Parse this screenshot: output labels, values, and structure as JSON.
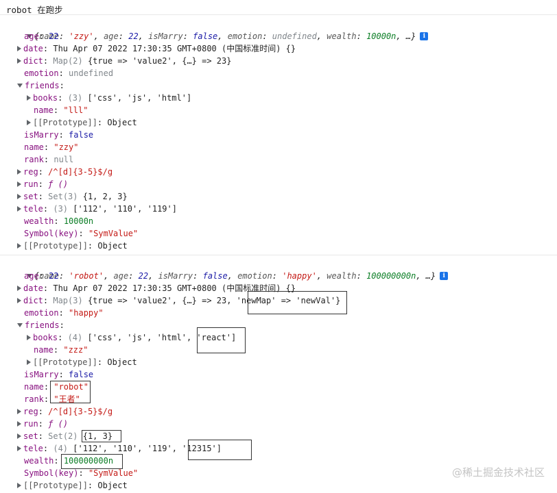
{
  "log": {
    "text": "robot 在跑步"
  },
  "first": {
    "summary": {
      "open": "{",
      "name_key": "name",
      "name_val": "'zzy'",
      "age_key": "age",
      "age_val": "22",
      "isMarry_key": "isMarry",
      "isMarry_val": "false",
      "emotion_key": "emotion",
      "emotion_val": "undefined",
      "wealth_key": "wealth",
      "wealth_val": "10000n",
      "tail": ", …}"
    },
    "age": {
      "key": "age",
      "val": "22"
    },
    "date": {
      "key": "date",
      "val": "Thu Apr 07 2022 17:30:35 GMT+0800 (中国标准时间) {}"
    },
    "dict": {
      "key": "dict",
      "pre": "Map(2) ",
      "val": "{true => 'value2', {…} => 23}"
    },
    "emotion": {
      "key": "emotion",
      "val": "undefined"
    },
    "friends": {
      "key": "friends",
      "books": {
        "key": "books",
        "pre": "(3) ",
        "val": "['css', 'js', 'html']"
      },
      "name": {
        "key": "name",
        "val": "\"lll\""
      },
      "proto": {
        "key": "[[Prototype]]",
        "val": "Object"
      }
    },
    "isMarry": {
      "key": "isMarry",
      "val": "false"
    },
    "name": {
      "key": "name",
      "val": "\"zzy\""
    },
    "rank": {
      "key": "rank",
      "val": "null"
    },
    "reg": {
      "key": "reg",
      "val": "/^[d]{3-5}$/g"
    },
    "run": {
      "key": "run",
      "val": "ƒ ()"
    },
    "set": {
      "key": "set",
      "pre": "Set(3) ",
      "val": "{1, 2, 3}"
    },
    "tele": {
      "key": "tele",
      "pre": "(3) ",
      "val": "['112', '110', '119']"
    },
    "wealth": {
      "key": "wealth",
      "val": "10000n"
    },
    "symbol": {
      "key": "Symbol(key)",
      "val": "\"SymValue\""
    },
    "proto": {
      "key": "[[Prototype]]",
      "val": "Object"
    }
  },
  "second": {
    "summary": {
      "open": "{",
      "name_key": "name",
      "name_val": "'robot'",
      "age_key": "age",
      "age_val": "22",
      "isMarry_key": "isMarry",
      "isMarry_val": "false",
      "emotion_key": "emotion",
      "emotion_val": "'happy'",
      "wealth_key": "wealth",
      "wealth_val": "100000000n",
      "tail": ", …}"
    },
    "age": {
      "key": "age",
      "val": "22"
    },
    "date": {
      "key": "date",
      "val": "Thu Apr 07 2022 17:30:35 GMT+0800 (中国标准时间) {}"
    },
    "dict": {
      "key": "dict",
      "pre": "Map(3) ",
      "val": "{true => 'value2', {…} => 23, 'newMap' => 'newVal'}"
    },
    "emotion": {
      "key": "emotion",
      "val": "\"happy\""
    },
    "friends": {
      "key": "friends",
      "books": {
        "key": "books",
        "pre": "(4) ",
        "val": "['css', 'js', 'html', 'react']"
      },
      "name": {
        "key": "name",
        "val": "\"zzz\""
      },
      "proto": {
        "key": "[[Prototype]]",
        "val": "Object"
      }
    },
    "isMarry": {
      "key": "isMarry",
      "val": "false"
    },
    "name": {
      "key": "name",
      "val": "\"robot\""
    },
    "rank": {
      "key": "rank",
      "val": "\"王者\""
    },
    "reg": {
      "key": "reg",
      "val": "/^[d]{3-5}$/g"
    },
    "run": {
      "key": "run",
      "val": "ƒ ()"
    },
    "set": {
      "key": "set",
      "pre": "Set(2) ",
      "val": "{1, 3}"
    },
    "tele": {
      "key": "tele",
      "pre": "(4) ",
      "val": "['112', '110', '119', '12315']"
    },
    "wealth": {
      "key": "wealth",
      "val": "100000000n"
    },
    "symbol": {
      "key": "Symbol(key)",
      "val": "\"SymValue\""
    },
    "proto": {
      "key": "[[Prototype]]",
      "val": "Object"
    }
  },
  "watermark": {
    "text": "@稀土掘金技术社区"
  }
}
